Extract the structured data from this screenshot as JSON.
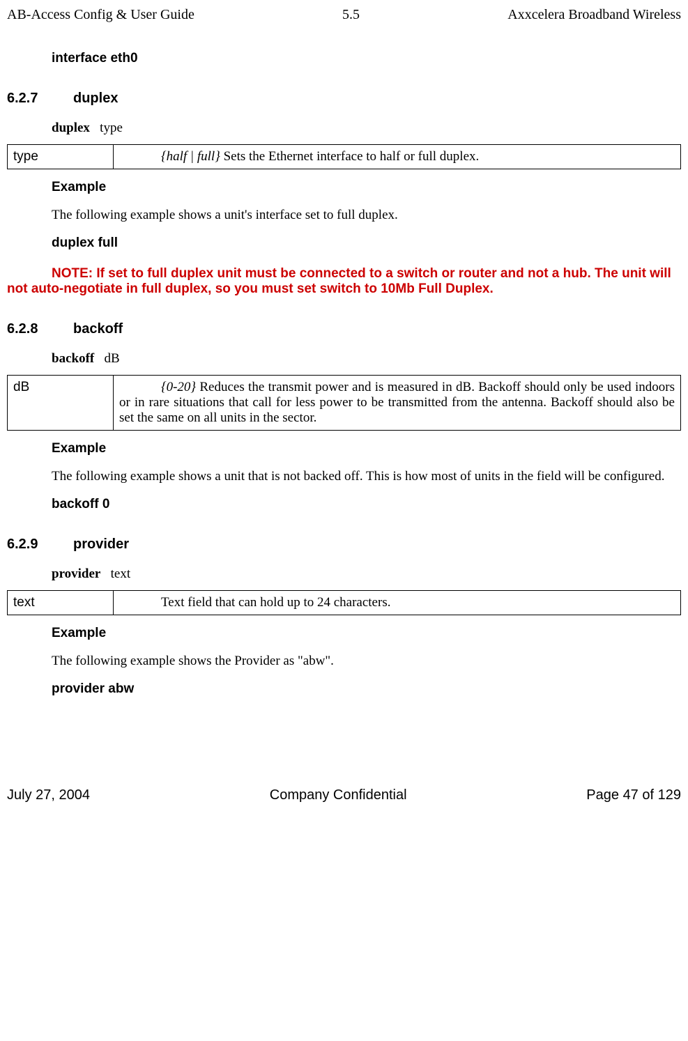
{
  "header": {
    "left": "AB-Access Config & User Guide",
    "center": "5.5",
    "right": "Axxcelera Broadband Wireless"
  },
  "intro_command": "interface  eth0",
  "sections": {
    "duplex": {
      "number": "6.2.7",
      "title": "duplex",
      "syntax_bold": "duplex",
      "syntax_arg": "type",
      "param_name": "type",
      "param_range": "{half | full}",
      "param_desc": " Sets the Ethernet interface to half or full duplex.",
      "example_heading": "Example",
      "example_text": "The following example shows a unit's interface set to full duplex.",
      "example_command": "duplex   full",
      "note": "NOTE: If set to full duplex unit must be connected to a switch or router and not a hub. The unit will not auto-negotiate in full duplex, so you must set switch to 10Mb Full Duplex."
    },
    "backoff": {
      "number": "6.2.8",
      "title": "backoff",
      "syntax_bold": "backoff",
      "syntax_arg": "dB",
      "param_name": "dB",
      "param_range": "{0-20}",
      "param_desc": " Reduces the transmit power and is measured in dB. Backoff should only be used indoors or in rare situations that call for less power to be transmitted from the antenna. Backoff should also be set the same on all units in the sector.",
      "example_heading": "Example",
      "example_text": "The following example shows a unit that is not backed off. This is how most of units in the field will be configured.",
      "example_command": "backoff   0"
    },
    "provider": {
      "number": "6.2.9",
      "title": "provider",
      "syntax_bold": "provider",
      "syntax_arg": "text",
      "param_name": "text",
      "param_desc_full": "Text field that can hold up to 24 characters.",
      "example_heading": "Example",
      "example_text": "The following example shows the Provider as \"abw\".",
      "example_command": "provider   abw"
    }
  },
  "footer": {
    "left": "July 27, 2004",
    "center": "Company Confidential",
    "right": "Page 47 of 129"
  }
}
